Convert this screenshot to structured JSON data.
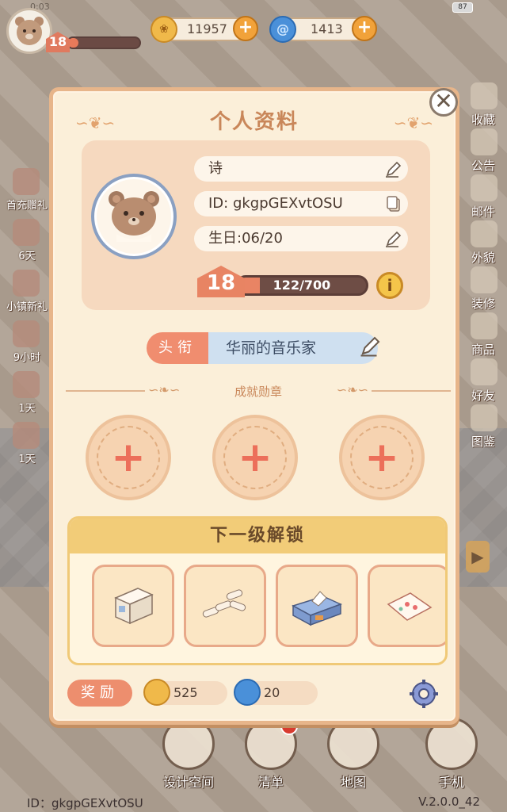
{
  "status": {
    "time": "0:03",
    "battery": "87"
  },
  "player": {
    "level": "18"
  },
  "currencies": [
    {
      "name": "coin",
      "value": "11957"
    },
    {
      "name": "gem",
      "value": "1413"
    }
  ],
  "left_events": [
    {
      "label": ""
    },
    {
      "label": "首充赠礼"
    },
    {
      "label": "6天"
    },
    {
      "label": "小镇新礼"
    },
    {
      "label": "9小时"
    },
    {
      "label": "1天"
    },
    {
      "label": "1天"
    }
  ],
  "right_menu": [
    {
      "label": "收藏"
    },
    {
      "label": "公告"
    },
    {
      "label": "邮件"
    },
    {
      "label": "外貌"
    },
    {
      "label": "装修"
    },
    {
      "label": "商品"
    },
    {
      "label": "好友"
    },
    {
      "label": "图鉴"
    }
  ],
  "bottom_nav": [
    {
      "label": "设计空间"
    },
    {
      "label": "清单"
    },
    {
      "label": "地图"
    },
    {
      "label": "手机"
    }
  ],
  "footer": {
    "id": "ID：gkgpGEXvtOSU",
    "version": "V.2.0.0_42"
  },
  "modal": {
    "title": "个人资料",
    "name": "诗",
    "id_text": "ID: gkgpGEXvtOSU",
    "birthday": "生日:06/20",
    "level": "18",
    "xp": "122/700",
    "xp_progress": 0.174,
    "info_symbol": "i",
    "title_tag": "头衔",
    "title_value": "华丽的音乐家",
    "achievement_label": "成就勋章",
    "unlock_title": "下一级解锁",
    "unlock_items": [
      {
        "icon": "cabinet-icon"
      },
      {
        "icon": "bandage-icon"
      },
      {
        "icon": "tissue-box-icon"
      },
      {
        "icon": "picture-icon"
      }
    ],
    "reward_tag": "奖励",
    "rewards": [
      {
        "icon": "coin-icon",
        "value": "525"
      },
      {
        "icon": "gem-icon",
        "value": "20"
      }
    ]
  },
  "colors": {
    "accent": "#e88463",
    "panel": "#fbefd9",
    "title_blue": "#cfe0f0"
  }
}
